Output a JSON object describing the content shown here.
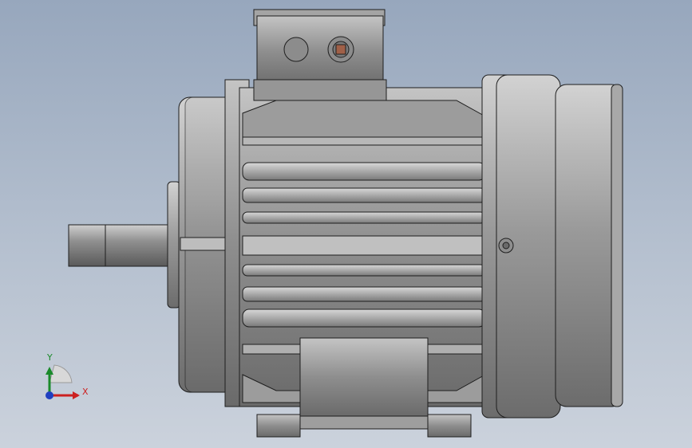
{
  "viewport": {
    "background_top": "#97a7bd",
    "background_bottom": "#cbd2dc"
  },
  "model": {
    "subject": "electric-motor",
    "body_color": "#8e8e8e",
    "edge_color": "#1e1e1e",
    "shaft_color": "#909090"
  },
  "triad": {
    "x_label": "X",
    "y_label": "Y",
    "x_color": "#cc2020",
    "y_color": "#1a8a2a",
    "z_color": "#2040c0"
  }
}
